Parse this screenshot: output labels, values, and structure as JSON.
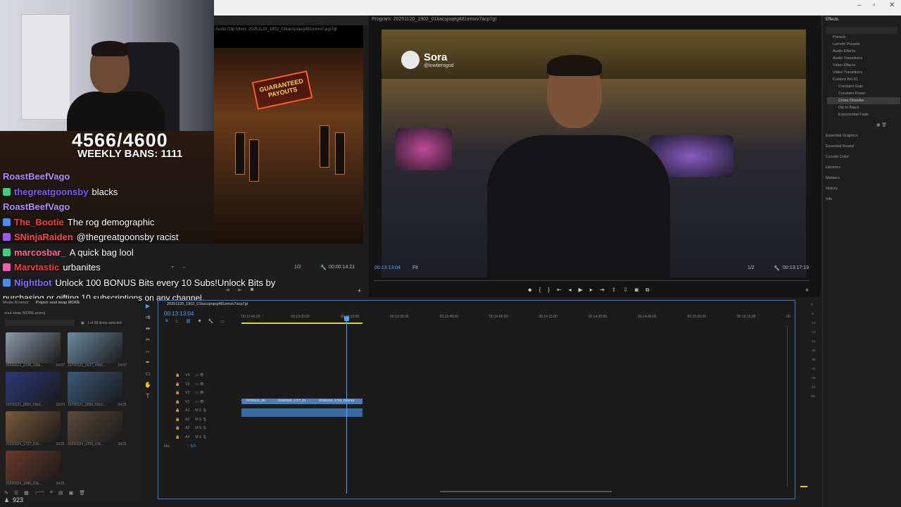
{
  "window": {
    "minimize": "–",
    "maximize": "▫",
    "close": "✕"
  },
  "stream": {
    "counter": "4566/4600",
    "weekly_bans": "WEEKLY BANS: 1111"
  },
  "chat": [
    {
      "user": "RoastBeefVago",
      "user_color": "#b48cff",
      "message": ""
    },
    {
      "user": "thegreatgoonsby",
      "user_color": "#7a5cff",
      "message": "blacks"
    },
    {
      "user": "RoastBeefVago",
      "user_color": "#b48cff",
      "message": ""
    },
    {
      "user": "The_Bootie",
      "user_color": "#ff3a3a",
      "message": "The rog demographic"
    },
    {
      "user": "SNinjaRaiden",
      "user_color": "#ff4a4a",
      "message": "@thegreatgoonsby racist"
    },
    {
      "user": "marcosbar_",
      "user_color": "#ff6a9a",
      "message": "A quick bag lool"
    },
    {
      "user": "Marvtastic",
      "user_color": "#ff3a3a",
      "message": "urbanites"
    },
    {
      "user": "Nightbot",
      "user_color": "#8a6aff",
      "message": "Unlock 100 BONUS Bits every 10 Subs!Unlock Bits by"
    },
    {
      "user": "",
      "user_color": "#ffffff",
      "message": "purchasing or gifting 10 subscriptions on any channel."
    }
  ],
  "source_monitor": {
    "title": "Audio Clip Mixer: 20251120_1902_01kacsjoqeg481emxv7acp7gt",
    "neon_sign": "GUARANTEED PAYOUTS",
    "zoom": "1/2",
    "timecode": "00:00:14:21"
  },
  "program_monitor": {
    "title": "Program: 20251120_1902_01kacsjoqeg481emxv7acp7gt",
    "watermark_name": "Sora",
    "watermark_handle": "@lowtiersgod",
    "timecode": "00:13:13:04",
    "fit": "Fit",
    "zoom": "1/2",
    "duration": "00:13:17:19"
  },
  "effects_panel": {
    "title": "Effects",
    "items": [
      {
        "label": "Presets",
        "level": 1,
        "selected": false
      },
      {
        "label": "Lumetri Presets",
        "level": 1,
        "selected": false
      },
      {
        "label": "Audio Effects",
        "level": 1,
        "selected": false
      },
      {
        "label": "Audio Transitions",
        "level": 1,
        "selected": false
      },
      {
        "label": "Video Effects",
        "level": 1,
        "selected": false
      },
      {
        "label": "Video Transitions",
        "level": 1,
        "selected": false
      },
      {
        "label": "Custom Bin 01",
        "level": 1,
        "selected": false
      },
      {
        "label": "Constant Gain",
        "level": 2,
        "selected": false
      },
      {
        "label": "Constant Power",
        "level": 2,
        "selected": false
      },
      {
        "label": "Cross Dissolve",
        "level": 2,
        "selected": true
      },
      {
        "label": "Dip to Black",
        "level": 2,
        "selected": false
      },
      {
        "label": "Exponential Fade",
        "level": 2,
        "selected": false
      }
    ],
    "sections": [
      "Essential Graphics",
      "Essential Sound",
      "Lumetri Color",
      "Libraries",
      "Markers",
      "History",
      "Info"
    ]
  },
  "project": {
    "tabs": [
      "Media Browser",
      "Project: soul swap MORE"
    ],
    "file": "soul swap MORE.prproj",
    "selection": "1 of 98 items selected",
    "clips": [
      {
        "name": "20260313_2338_01kk...",
        "dur": "14:07",
        "color": "#8a9aa8"
      },
      {
        "name": "19700121_0637_49h5...",
        "dur": "14:07",
        "color": "#6a8aa0"
      },
      {
        "name": "19700121_0650_69c0...",
        "dur": "13:24",
        "color": "#2a3a7a"
      },
      {
        "name": "19700121_0650_69c0...",
        "dur": "14:21",
        "color": "#3a5a7a"
      },
      {
        "name": "20260324_1727_01k...",
        "dur": "14:21",
        "color": "#7a5a3a"
      },
      {
        "name": "20260324_1720_01k...",
        "dur": "14:21",
        "color": "#5a4a3a"
      },
      {
        "name": "20260324_1945_01k...",
        "dur": "14:21",
        "color": "#6a3a2a"
      }
    ]
  },
  "timeline": {
    "tab": "20251120_1902_01kacsjoqeg481emxv7acp7gt",
    "timecode": "00:13:13:04",
    "ruler": [
      "00:12:45:00",
      "00:13:00:00",
      "00:13:15:00",
      "00:13:30:00",
      "00:13:45:00",
      "00:14:00:00",
      "00:14:15:00",
      "00:14:30:00",
      "00:14:45:00",
      "00:15:00:00",
      "00:15:15:00",
      "00"
    ],
    "video_tracks": [
      "V4",
      "V3",
      "V2",
      "V1"
    ],
    "audio_tracks": [
      "A1",
      "A2",
      "A3",
      "A4"
    ],
    "mix_label": "Mix",
    "mix_value": "0.0",
    "clip_labels": [
      "19700121_06",
      "20260324_1727_01",
      "20260324_1723_01kmkd"
    ]
  },
  "audio_meter": [
    "0",
    "-6",
    "-12",
    "-18",
    "-24",
    "-30",
    "-36",
    "-42",
    "-48",
    "-54",
    "dB"
  ],
  "footer": {
    "count": "923"
  }
}
